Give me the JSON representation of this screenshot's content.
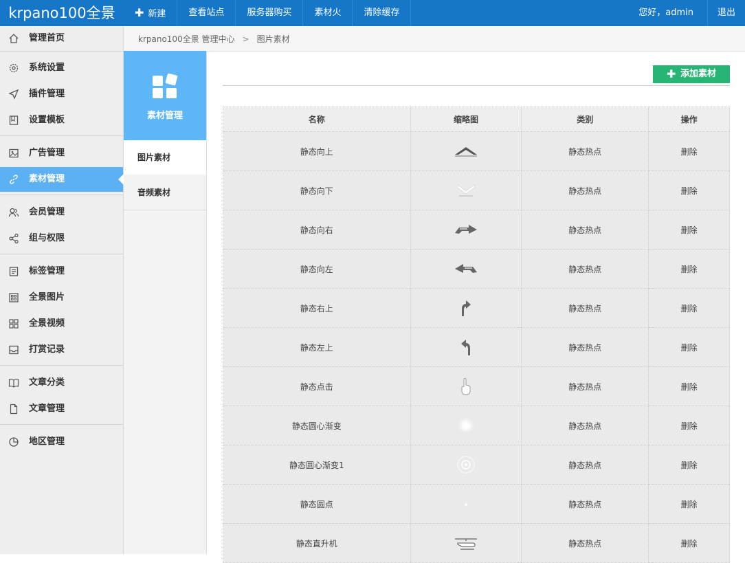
{
  "header": {
    "logo": "krpano100全景",
    "nav": [
      {
        "label": "新建",
        "icon": "plus-icon"
      },
      {
        "label": "查看站点"
      },
      {
        "label": "服务器购买"
      },
      {
        "label": "素材火"
      },
      {
        "label": "清除缓存"
      }
    ],
    "greeting": "您好，admin",
    "logout": "退出"
  },
  "sidebar": {
    "items": [
      {
        "label": "管理首页",
        "icon": "home-icon"
      },
      {
        "label": "系统设置",
        "icon": "gear-icon"
      },
      {
        "label": "插件管理",
        "icon": "send-icon"
      },
      {
        "label": "设置模板",
        "icon": "book-icon"
      },
      {
        "label": "广告管理",
        "icon": "image-icon"
      },
      {
        "label": "素材管理",
        "icon": "link-icon",
        "active": true
      },
      {
        "label": "会员管理",
        "icon": "users-icon"
      },
      {
        "label": "组与权限",
        "icon": "share-icon"
      },
      {
        "label": "标签管理",
        "icon": "list-icon"
      },
      {
        "label": "全景图片",
        "icon": "grid-icon"
      },
      {
        "label": "全景视频",
        "icon": "apps-icon"
      },
      {
        "label": "打赏记录",
        "icon": "inbox-icon"
      },
      {
        "label": "文章分类",
        "icon": "open-book-icon"
      },
      {
        "label": "文章管理",
        "icon": "file-icon"
      },
      {
        "label": "地区管理",
        "icon": "pie-icon"
      }
    ]
  },
  "breadcrumb": {
    "root": "krpano100全景 管理中心",
    "separator": ">",
    "current": "图片素材"
  },
  "submenu": {
    "title": "素材管理",
    "items": [
      {
        "label": "图片素材",
        "active": true
      },
      {
        "label": "音频素材"
      }
    ]
  },
  "main": {
    "add_button": "添加素材",
    "table": {
      "headers": [
        "名称",
        "缩略图",
        "类别",
        "操作"
      ],
      "rows": [
        {
          "name": "静态向上",
          "thumb": "arrow-up-icon",
          "type": "静态热点",
          "action": "删除"
        },
        {
          "name": "静态向下",
          "thumb": "arrow-down-icon",
          "type": "静态热点",
          "action": "删除"
        },
        {
          "name": "静态向右",
          "thumb": "arrow-right-icon",
          "type": "静态热点",
          "action": "删除"
        },
        {
          "name": "静态向左",
          "thumb": "arrow-left-icon",
          "type": "静态热点",
          "action": "删除"
        },
        {
          "name": "静态右上",
          "thumb": "arrow-upright-icon",
          "type": "静态热点",
          "action": "删除"
        },
        {
          "name": "静态左上",
          "thumb": "arrow-upleft-icon",
          "type": "静态热点",
          "action": "删除"
        },
        {
          "name": "静态点击",
          "thumb": "hand-pointer-icon",
          "type": "静态热点",
          "action": "删除"
        },
        {
          "name": "静态圆心渐变",
          "thumb": "radial-glow-icon",
          "type": "静态热点",
          "action": "删除"
        },
        {
          "name": "静态圆心渐变1",
          "thumb": "ring-glow-icon",
          "type": "静态热点",
          "action": "删除"
        },
        {
          "name": "静态圆点",
          "thumb": "dot-icon",
          "type": "静态热点",
          "action": "删除"
        },
        {
          "name": "静态直升机",
          "thumb": "helicopter-icon",
          "type": "静态热点",
          "action": "删除"
        }
      ]
    }
  },
  "colors": {
    "topbar": "#1677c9",
    "active": "#5cb1f5",
    "submenu_head": "#5cb6f8",
    "add_button": "#26b574"
  }
}
